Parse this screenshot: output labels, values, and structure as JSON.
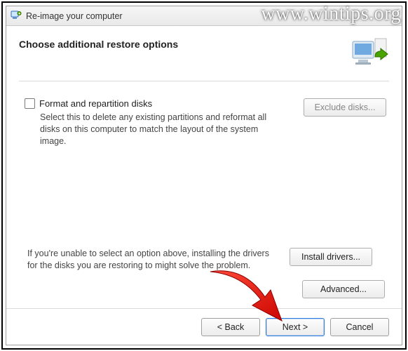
{
  "watermark": "www.wintips.org",
  "window": {
    "title": "Re-image your computer",
    "heading": "Choose additional restore options"
  },
  "format": {
    "checkbox_label": "Format and repartition disks",
    "description": "Select this to delete any existing partitions and reformat all disks on this computer to match the layout of the system image.",
    "exclude_button": "Exclude disks..."
  },
  "drivers": {
    "description": "If you're unable to select an option above, installing the drivers for the disks you are restoring to might solve the problem.",
    "install_button": "Install drivers...",
    "advanced_button": "Advanced..."
  },
  "footer": {
    "back": "< Back",
    "next": "Next >",
    "cancel": "Cancel"
  }
}
